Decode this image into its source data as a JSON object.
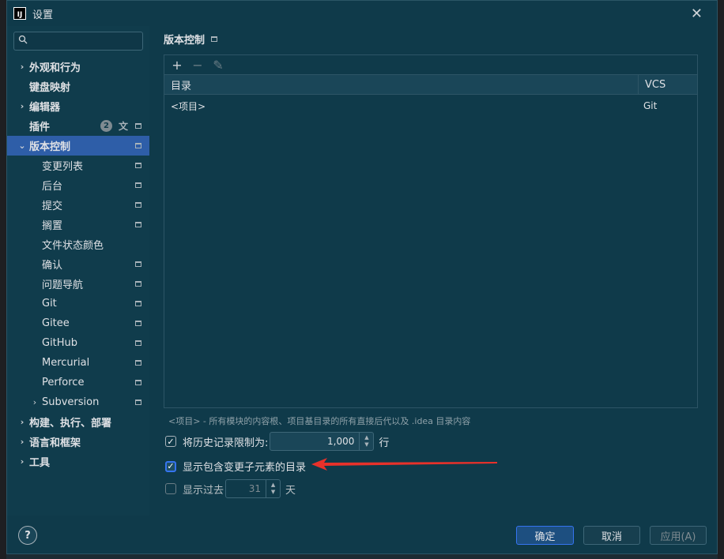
{
  "window": {
    "title": "设置",
    "app_icon": "intellij-icon"
  },
  "sidebar": {
    "search_placeholder": "",
    "items": [
      {
        "label": "外观和行为",
        "chevron": "›",
        "bold": true
      },
      {
        "label": "键盘映射",
        "chevron": "",
        "bold": true
      },
      {
        "label": "编辑器",
        "chevron": "›",
        "bold": true
      },
      {
        "label": "插件",
        "chevron": "",
        "bold": true,
        "badge": "2"
      },
      {
        "label": "版本控制",
        "chevron": "⌄",
        "bold": true,
        "selected": true
      },
      {
        "label": "变更列表"
      },
      {
        "label": "后台"
      },
      {
        "label": "提交"
      },
      {
        "label": "搁置"
      },
      {
        "label": "文件状态颜色"
      },
      {
        "label": "确认"
      },
      {
        "label": "问题导航"
      },
      {
        "label": "Git"
      },
      {
        "label": "Gitee"
      },
      {
        "label": "GitHub"
      },
      {
        "label": "Mercurial"
      },
      {
        "label": "Perforce"
      },
      {
        "label": "Subversion",
        "chevron": "›"
      },
      {
        "label": "构建、执行、部署",
        "chevron": "›",
        "bold": true
      },
      {
        "label": "语言和框架",
        "chevron": "›",
        "bold": true
      },
      {
        "label": "工具",
        "chevron": "›",
        "bold": true
      }
    ]
  },
  "main": {
    "breadcrumb": "版本控制",
    "toolbar": {
      "add": "+",
      "remove": "−",
      "edit": "✎"
    },
    "table": {
      "headers": [
        "目录",
        "VCS"
      ],
      "rows": [
        {
          "dir": "<项目>",
          "vcs": "Git"
        }
      ]
    },
    "hint": "<项目> - 所有模块的内容根、项目基目录的所有直接后代以及 .idea 目录内容",
    "history_limit": {
      "label": "将历史记录限制为:",
      "value": "1,000",
      "unit": "行",
      "checked": true
    },
    "show_dirs": {
      "label": "显示包含变更子元素的目录",
      "checked": true
    },
    "show_past": {
      "label": "显示过去",
      "value": "31",
      "unit": "天",
      "checked": false
    }
  },
  "footer": {
    "help": "?",
    "ok": "确定",
    "cancel": "取消",
    "apply": "应用(A)"
  },
  "colors": {
    "accent": "#3574f0",
    "selected": "#2e5ea8",
    "annotation_arrow": "#e8312a"
  }
}
